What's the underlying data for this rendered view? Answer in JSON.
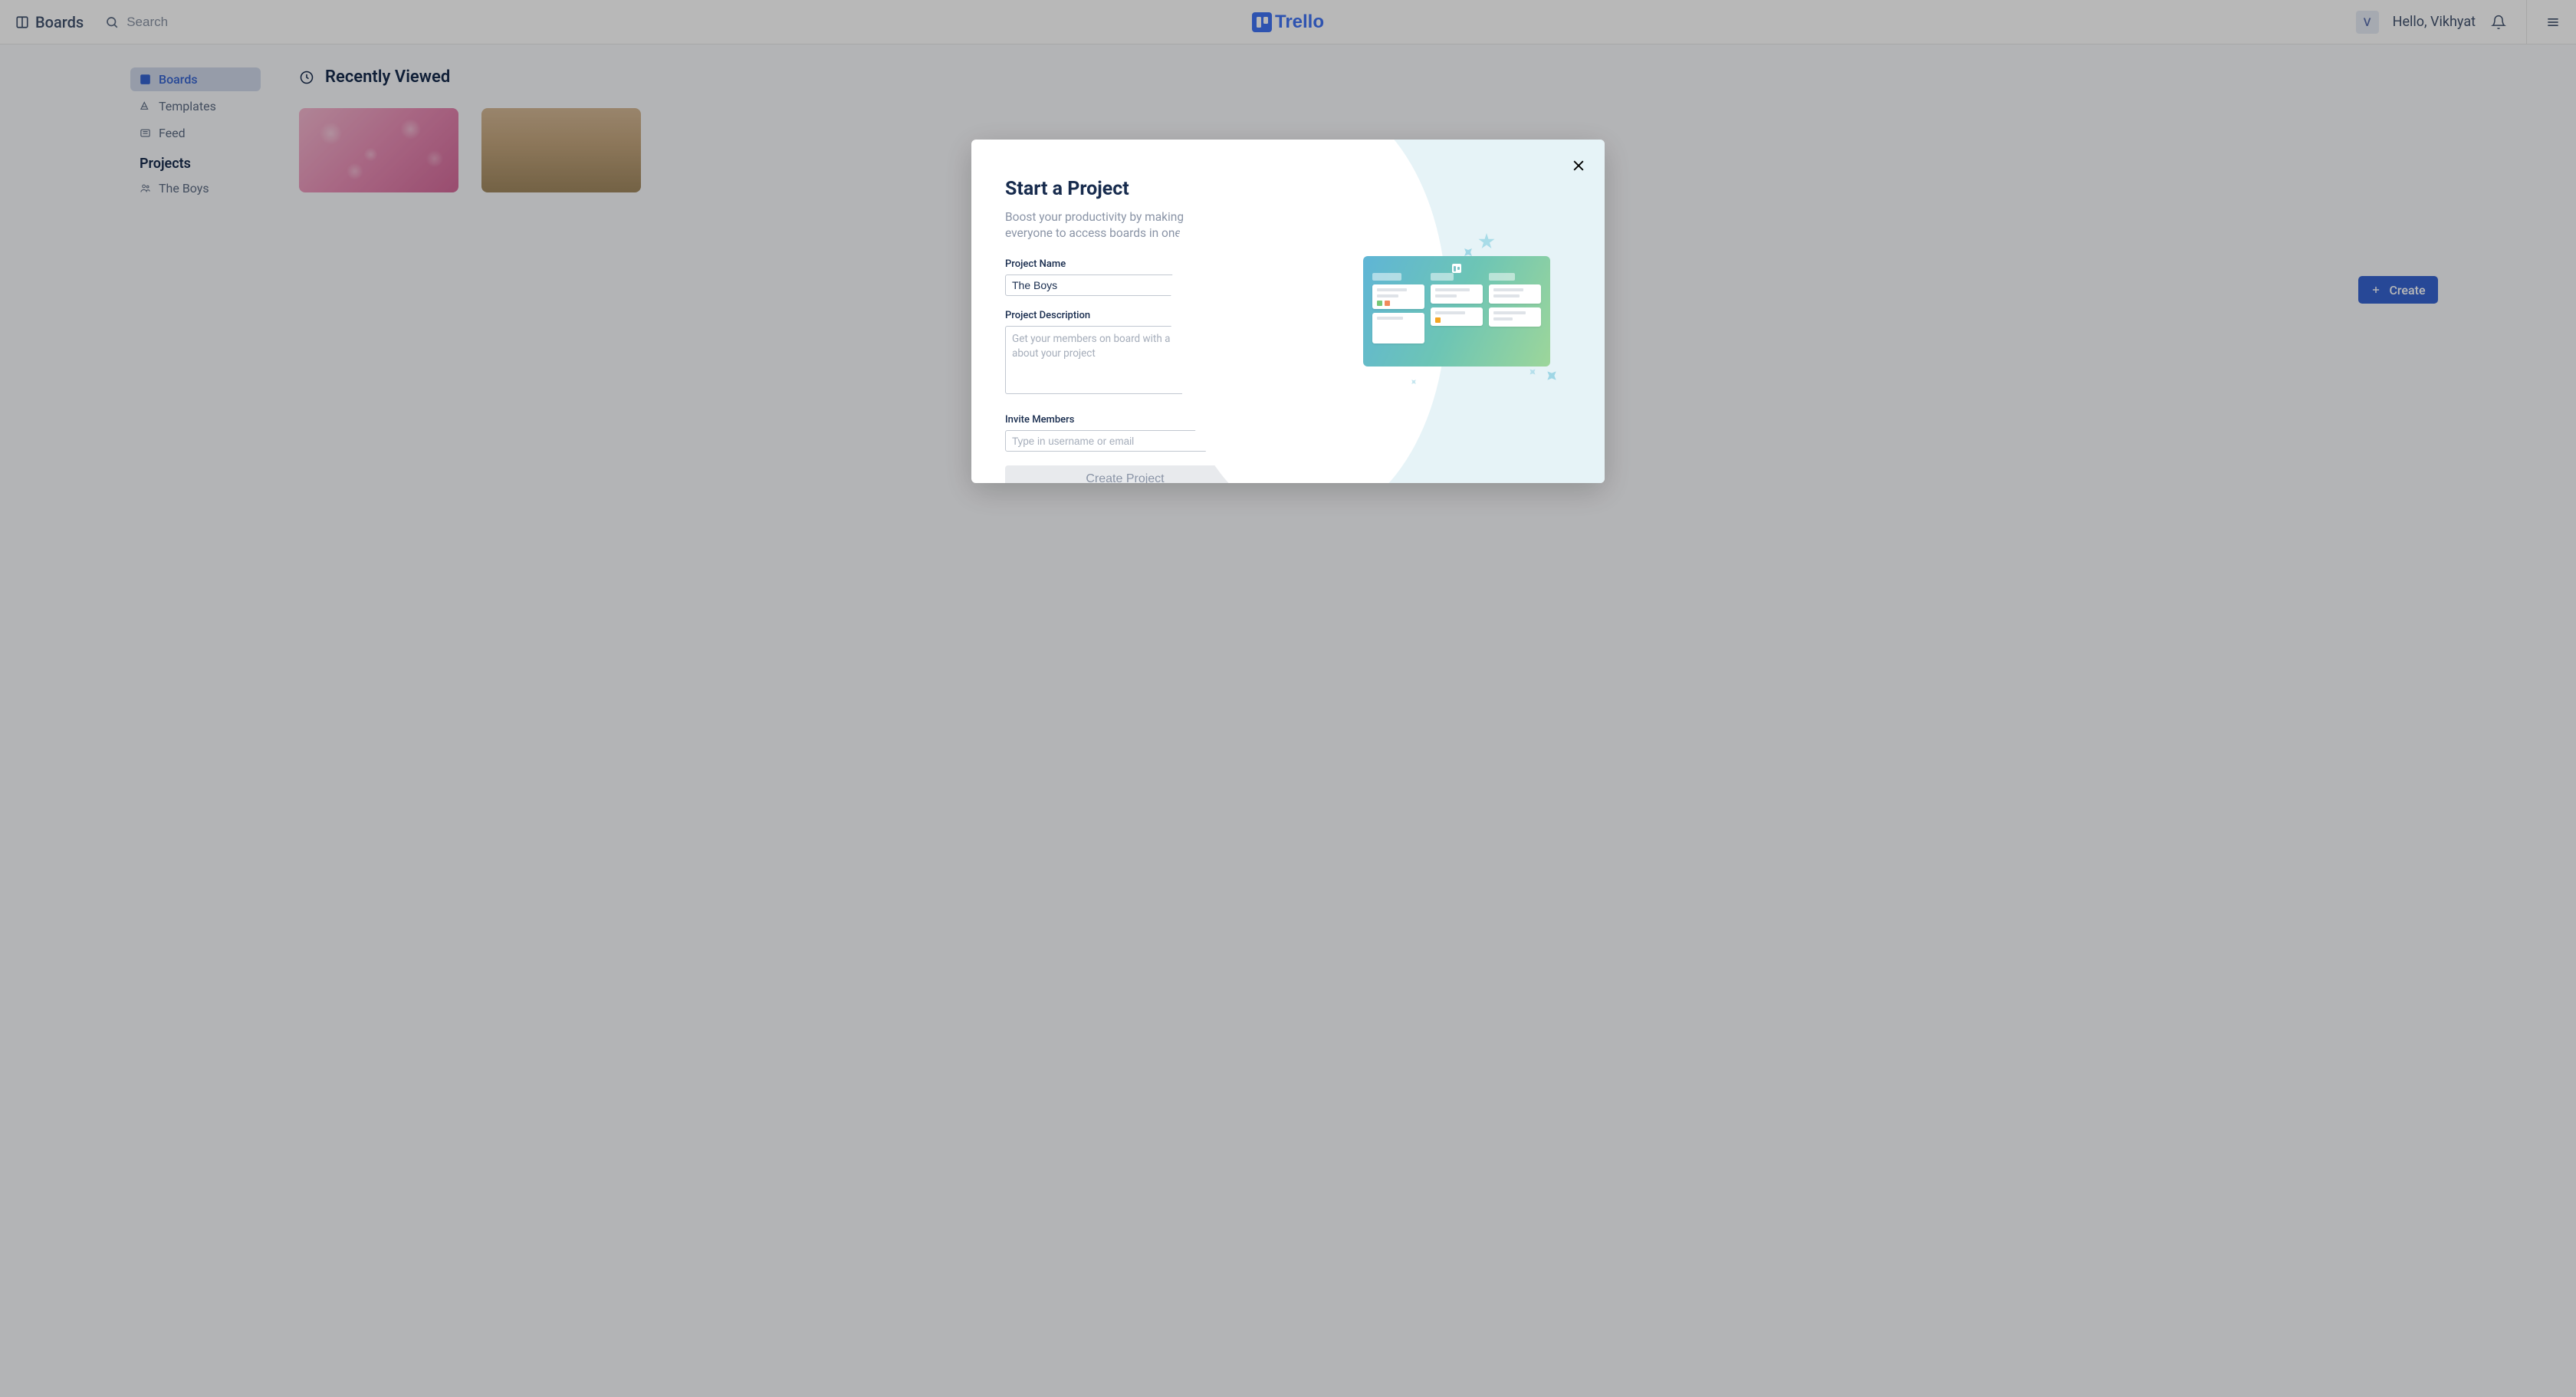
{
  "header": {
    "boards_label": "Boards",
    "search_placeholder": "Search",
    "logo_text": "Trello",
    "avatar_initial": "V",
    "greeting": "Hello, Vikhyat"
  },
  "sidebar": {
    "items": [
      {
        "label": "Boards"
      },
      {
        "label": "Templates"
      },
      {
        "label": "Feed"
      }
    ],
    "projects_header": "Projects",
    "projects": [
      {
        "label": "The Boys"
      }
    ]
  },
  "main": {
    "section_title": "Recently Viewed",
    "create_label": "Create"
  },
  "modal": {
    "title": "Start a Project",
    "description": "Boost your productivity by making it easier for everyone to access boards in one location.",
    "name_label": "Project Name",
    "name_value": "The Boys",
    "desc_label": "Project Description",
    "desc_placeholder": "Get your members on board with a few words about your project",
    "invite_label": "Invite Members",
    "invite_placeholder": "Type in username or email",
    "submit_label": "Create Project"
  }
}
